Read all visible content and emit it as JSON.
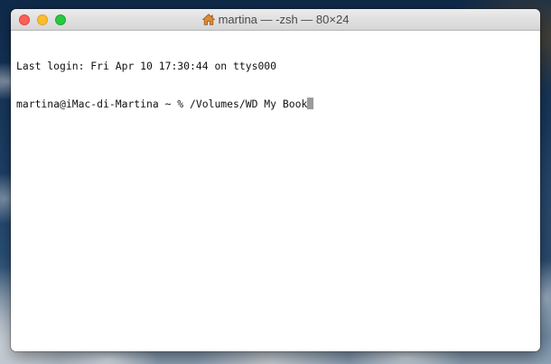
{
  "window": {
    "title": "martina — -zsh — 80×24",
    "title_icon": "home-icon"
  },
  "terminal": {
    "lines": [
      "Last login: Fri Apr 10 17:30:44 on ttys000",
      "martina@iMac-di-Martina ~ % /Volumes/WD My Book"
    ],
    "cursor_color": "#9b9b9b"
  },
  "colors": {
    "close": "#fc5f57",
    "minimize": "#fdbc2e",
    "zoom": "#28c840"
  }
}
